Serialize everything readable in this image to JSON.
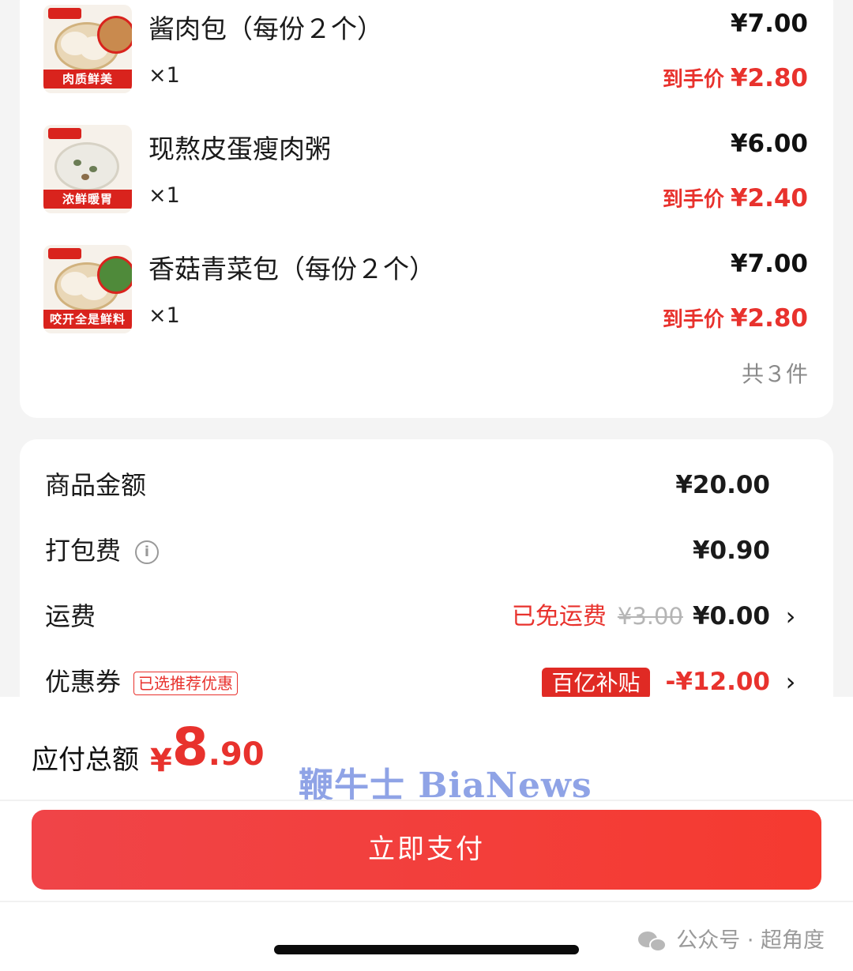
{
  "items": [
    {
      "name": "酱肉包（每份２个）",
      "qty": "×1",
      "price": "¥7.00",
      "final_label": "到手价",
      "final_price": "¥2.80",
      "image_banner": "肉质鲜美",
      "image_kind": "bun"
    },
    {
      "name": "现熬皮蛋瘦肉粥",
      "qty": "×1",
      "price": "¥6.00",
      "final_label": "到手价",
      "final_price": "¥2.40",
      "image_banner": "浓鲜暖胃",
      "image_kind": "congee"
    },
    {
      "name": "香菇青菜包（每份２个）",
      "qty": "×1",
      "price": "¥7.00",
      "final_label": "到手价",
      "final_price": "¥2.80",
      "image_banner": "咬开全是鲜料",
      "image_kind": "bun"
    }
  ],
  "items_count": "共３件",
  "summary": {
    "goods": {
      "label": "商品金额",
      "value": "¥20.00"
    },
    "packing": {
      "label": "打包费",
      "value": "¥0.90",
      "icon": "info-icon"
    },
    "shipping": {
      "label": "运费",
      "free_text": "已免运费",
      "original": "¥3.00",
      "value": "¥0.00"
    },
    "coupon": {
      "label": "优惠券",
      "tag": "已选推荐优惠",
      "badge": "百亿补贴",
      "value": "-¥12.00"
    }
  },
  "total": {
    "label": "应付总额",
    "currency": "¥",
    "integer": "8",
    "decimal": ".90"
  },
  "watermark": "鞭牛士 BiaNews",
  "pay_button": "立即支付",
  "source": "公众号 · 超角度",
  "colors": {
    "accent": "#e8322d",
    "button": "#f04448",
    "background": "#f4f4f4"
  }
}
